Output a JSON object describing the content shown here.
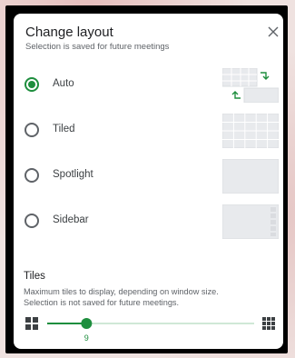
{
  "dialog": {
    "title": "Change layout",
    "subtitle": "Selection is saved for future meetings",
    "close_icon": "close-icon"
  },
  "layout_options": [
    {
      "label": "Auto",
      "checked": true,
      "thumbnail": "auto-layout-icon"
    },
    {
      "label": "Tiled",
      "checked": false,
      "thumbnail": "tiled-layout-icon"
    },
    {
      "label": "Spotlight",
      "checked": false,
      "thumbnail": "spotlight-layout-icon"
    },
    {
      "label": "Sidebar",
      "checked": false,
      "thumbnail": "sidebar-layout-icon"
    }
  ],
  "tiles": {
    "title": "Tiles",
    "description_line1": "Maximum tiles to display, depending on window size.",
    "description_line2": "Selection is not saved for future meetings.",
    "slider_value": "9",
    "slider_fraction": 0.19,
    "min_icon": "few-tiles-icon",
    "max_icon": "many-tiles-icon"
  },
  "colors": {
    "accent": "#1e8e3e",
    "track_inactive": "#cfe8d6",
    "thumbnail_fill": "#e8eaed",
    "thumbnail_border": "#dadce0"
  }
}
